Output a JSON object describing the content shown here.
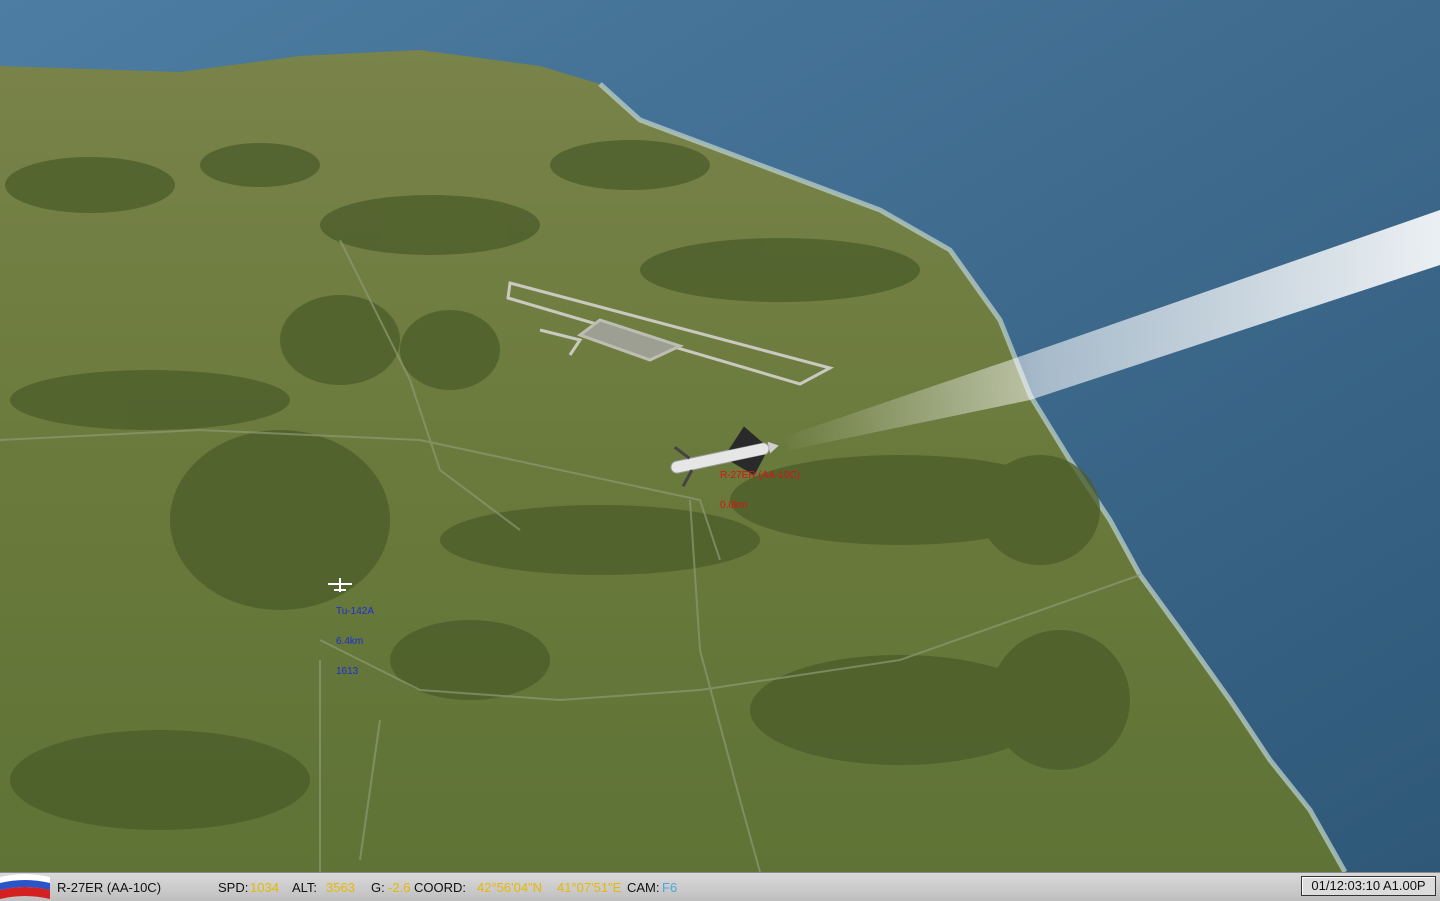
{
  "scene": {
    "view": "external camera, missile over coastline",
    "colors": {
      "sea": "#3f6b8e",
      "land": "#6b7a3a",
      "hud_friendly": "#1a2fd6",
      "hud_missile": "#e01010"
    }
  },
  "labels": {
    "missile": {
      "line1": "R-27ER (AA-10C)",
      "line2": "0.0km"
    },
    "aircraft": {
      "line1": "Tu-142A",
      "line2": "6.4km",
      "line3": "1613"
    }
  },
  "status_bar": {
    "flag_icon": "russian-flag-icon",
    "object_name": "R-27ER (AA-10C)",
    "spd_label": "SPD:",
    "spd_value": "1034",
    "alt_label": "ALT:",
    "alt_value": "3563",
    "g_label": "G:",
    "g_value": "-2.6",
    "coord_label": "COORD:",
    "lat": "42°56'04\"N",
    "lon": "41°07'51\"E",
    "cam_label": "CAM:",
    "cam_value": "F6",
    "clock": "01/12:03:10 A1.00P"
  }
}
